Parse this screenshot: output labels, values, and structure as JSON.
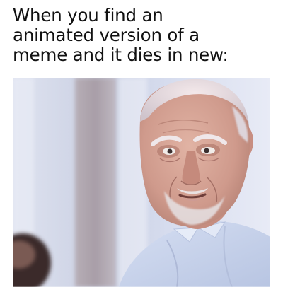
{
  "meme": {
    "caption_lines": [
      "When you find an",
      "animated version of a",
      "meme and it dies in new:"
    ]
  },
  "photo": {
    "icon": "worried-older-man-photo",
    "colors": {
      "background": "#cfd6e8",
      "shirt": "#c8d4ec",
      "skin": "#d7a99a",
      "beard": "#e6e2e4"
    }
  }
}
